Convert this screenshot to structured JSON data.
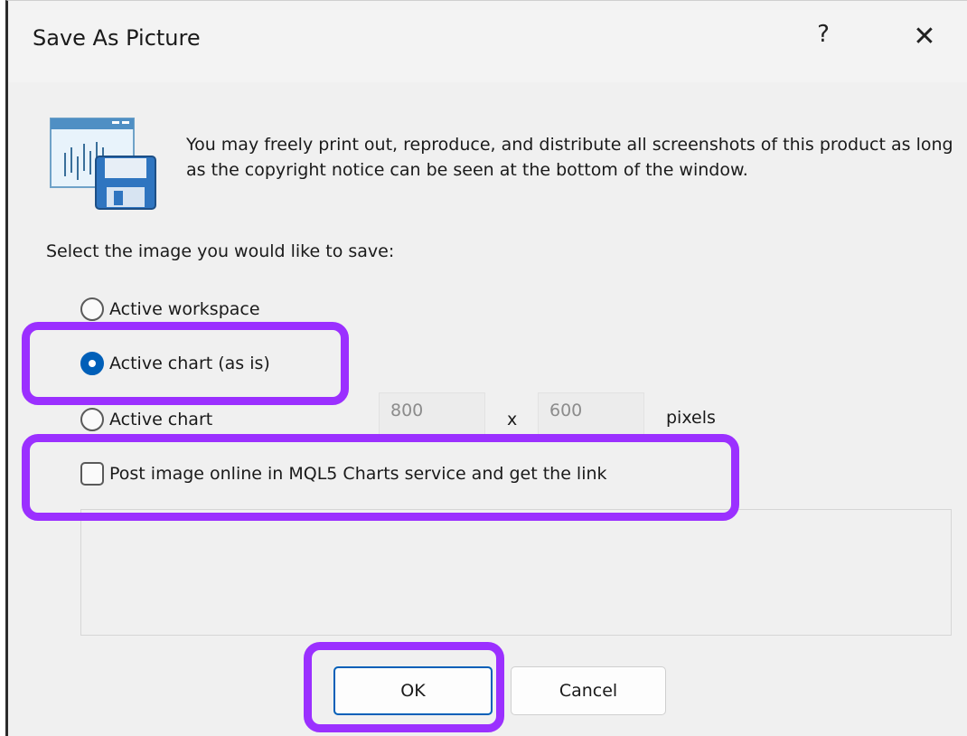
{
  "dialog": {
    "title": "Save As Picture",
    "help": "?",
    "close": "✕"
  },
  "notice": "You may freely print out, reproduce, and distribute all screenshots of this product as long as the copyright notice can be seen at the bottom of the window.",
  "select_label": "Select the image you would like to save:",
  "options": {
    "workspace": {
      "label": "Active workspace",
      "checked": false
    },
    "chart_as_is": {
      "label": "Active chart (as is)",
      "checked": true
    },
    "chart_sized": {
      "label": "Active chart",
      "checked": false
    }
  },
  "size": {
    "width": "800",
    "separator": "x",
    "height": "600",
    "unit": "pixels"
  },
  "post_online": {
    "label": "Post image online in MQL5 Charts service and get the link",
    "checked": false
  },
  "buttons": {
    "ok": "OK",
    "cancel": "Cancel"
  },
  "colors": {
    "accent": "#005fb8",
    "highlight": "#9b30ff",
    "background": "#f0f0f0"
  },
  "icons": {
    "app": "chart-save-icon"
  }
}
